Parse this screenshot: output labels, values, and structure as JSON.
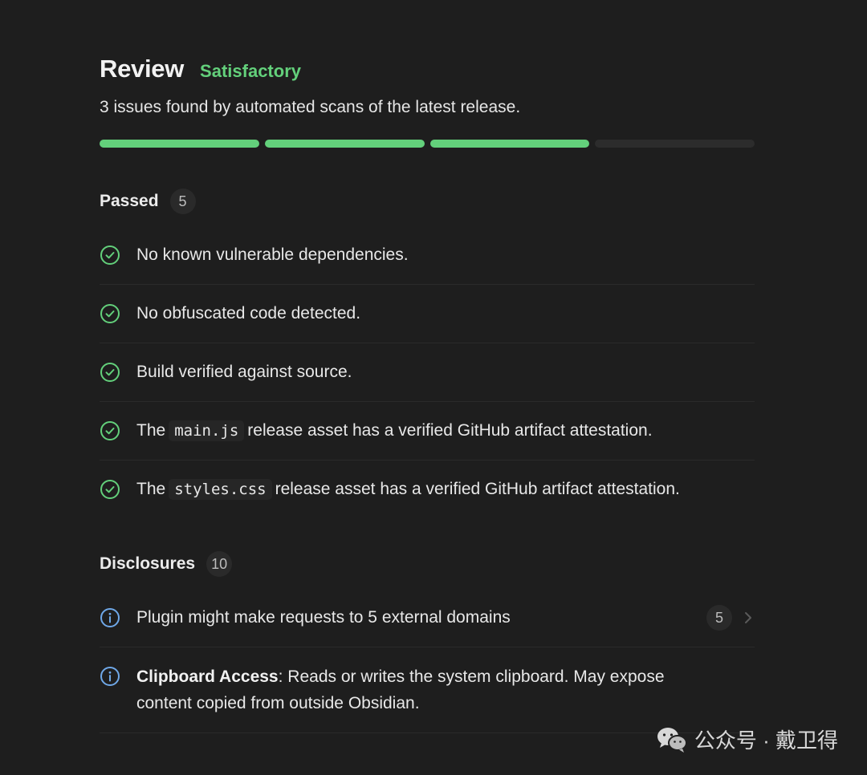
{
  "header": {
    "title": "Review",
    "rating": "Satisfactory",
    "subtitle": "3 issues found by automated scans of the latest release.",
    "progress_filled_segments": 3,
    "progress_total_segments": 4
  },
  "passed": {
    "title": "Passed",
    "count": "5",
    "items": [
      {
        "pre": "No known vulnerable dependencies.",
        "code": "",
        "post": ""
      },
      {
        "pre": "No obfuscated code detected.",
        "code": "",
        "post": ""
      },
      {
        "pre": "Build verified against source.",
        "code": "",
        "post": ""
      },
      {
        "pre": "The",
        "code": "main.js",
        "post": "release asset has a verified GitHub artifact attestation."
      },
      {
        "pre": "The",
        "code": "styles.css",
        "post": "release asset has a verified GitHub artifact attestation."
      }
    ]
  },
  "disclosures": {
    "title": "Disclosures",
    "count": "10",
    "items": [
      {
        "text": "Plugin might make requests to 5 external domains",
        "badge": "5"
      },
      {
        "bold": "Clipboard Access",
        "text": ": Reads or writes the system clipboard. May expose content copied from outside Obsidian."
      }
    ]
  },
  "watermark": {
    "text": "公众号 · 戴卫得",
    "icon": "wechat-icon"
  },
  "colors": {
    "accent_green": "#63d07b",
    "info_blue": "#6fa8e8",
    "background": "#1e1e1e"
  }
}
